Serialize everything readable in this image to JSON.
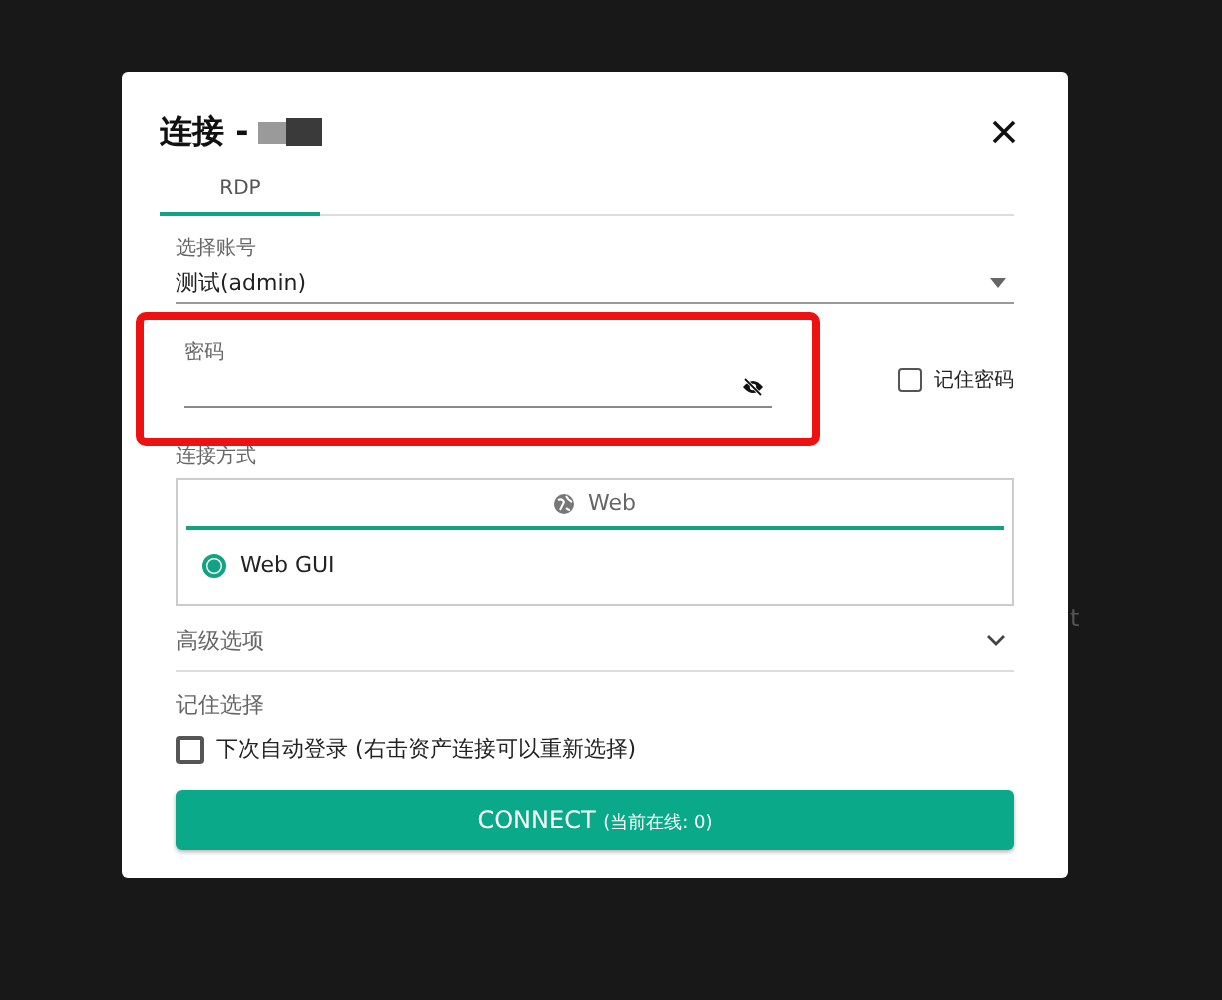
{
  "dialog": {
    "title": "连接 -",
    "tabs": [
      {
        "label": "RDP",
        "selected": true
      }
    ],
    "account": {
      "label": "选择账号",
      "value": "测试(admin)"
    },
    "password": {
      "label": "密码",
      "highlighted": true
    },
    "remember_password": {
      "label": "记住密码",
      "checked": false
    },
    "connect_method": {
      "label": "连接方式",
      "tabs": [
        {
          "label": "Web",
          "selected": true
        }
      ],
      "options": [
        {
          "label": "Web GUI",
          "selected": true
        }
      ]
    },
    "advanced": {
      "label": "高级选项",
      "expanded": false
    },
    "remember_choice": {
      "label": "记住选择",
      "option": {
        "label": "下次自动登录 (右击资产连接可以重新选择)",
        "checked": false
      }
    },
    "connect_button": {
      "label": "CONNECT",
      "note": "(当前在线: 0)"
    }
  },
  "background_text": "t"
}
